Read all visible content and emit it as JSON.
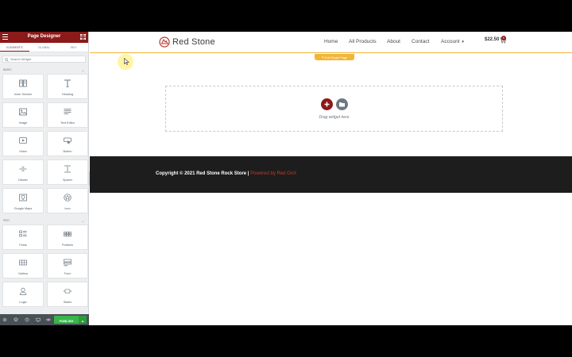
{
  "sidebar": {
    "title": "Page Designer",
    "tabs": [
      "ELEMENTS",
      "GLOBAL",
      "SEO"
    ],
    "search_placeholder": "Search Widget",
    "basic_label": "BASIC",
    "pro_label": "PRO",
    "basic_widgets": [
      {
        "label": "Inner Section",
        "icon": "inner-section-icon"
      },
      {
        "label": "Heading",
        "icon": "heading-icon"
      },
      {
        "label": "Image",
        "icon": "image-icon"
      },
      {
        "label": "Text Editor",
        "icon": "text-editor-icon"
      },
      {
        "label": "Video",
        "icon": "video-icon"
      },
      {
        "label": "Button",
        "icon": "button-icon"
      },
      {
        "label": "Divider",
        "icon": "divider-icon"
      },
      {
        "label": "Spacer",
        "icon": "spacer-icon"
      },
      {
        "label": "Google Maps",
        "icon": "map-icon"
      },
      {
        "label": "Icon",
        "icon": "star-icon"
      }
    ],
    "pro_widgets": [
      {
        "label": "Posts",
        "icon": "posts-icon"
      },
      {
        "label": "Portfolio",
        "icon": "portfolio-icon"
      },
      {
        "label": "Gallery",
        "icon": "gallery-icon"
      },
      {
        "label": "Form",
        "icon": "form-icon"
      },
      {
        "label": "Login",
        "icon": "login-icon"
      },
      {
        "label": "Slides",
        "icon": "slides-icon"
      }
    ],
    "publish_label": "PUBLISH"
  },
  "site": {
    "logo_text": "Red Stone",
    "nav": [
      "Home",
      "All Products",
      "About",
      "Contact",
      "Account"
    ],
    "cart_price": "$22.50",
    "cart_count": "0",
    "edit_tab_label": "Edit Single Page",
    "drag_text": "Drag widget here",
    "footer_copyright": "Copyright © 2021 Red Stone Rock Store |",
    "footer_powered": "Powered by Red OnX"
  },
  "colors": {
    "brand": "#8b1a1a",
    "accent": "#f2b535",
    "publish": "#39b54a",
    "footer_bg": "#1d1d1d"
  }
}
